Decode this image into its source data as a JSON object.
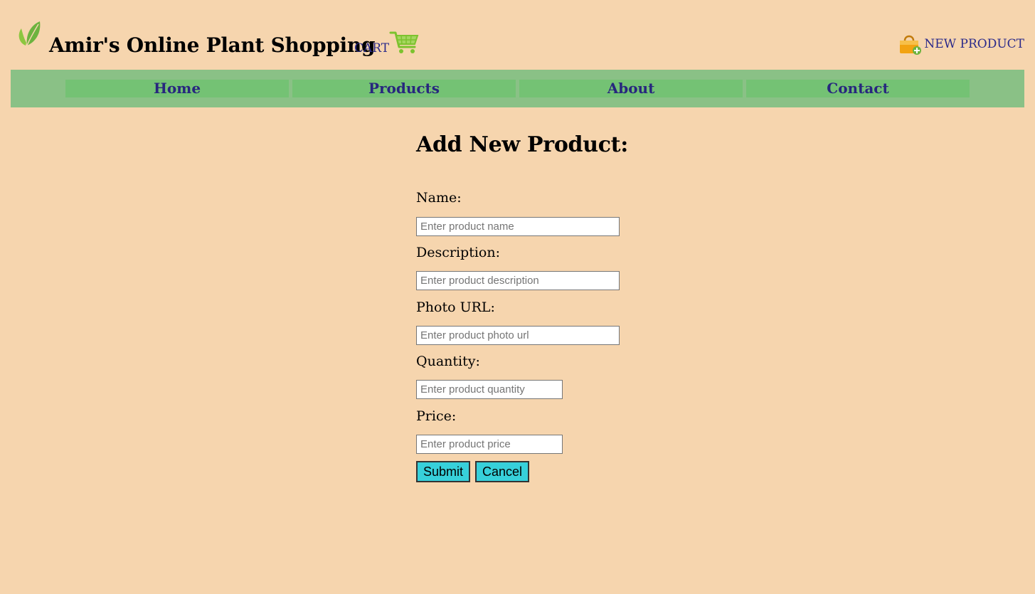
{
  "header": {
    "logo_icon": "leaf-icon",
    "title": "Amir's Online Plant Shopping",
    "cart_label": "CART",
    "cart_icon": "shopping-cart-icon",
    "new_product_icon": "shopping-bag-add-icon",
    "new_product_label": "NEW PRODUCT"
  },
  "nav": {
    "items": [
      {
        "label": "Home"
      },
      {
        "label": "Products"
      },
      {
        "label": "About"
      },
      {
        "label": "Contact"
      }
    ]
  },
  "form": {
    "heading": "Add New Product:",
    "fields": {
      "name": {
        "label": "Name:",
        "placeholder": "Enter product name",
        "value": ""
      },
      "description": {
        "label": "Description:",
        "placeholder": "Enter product description",
        "value": ""
      },
      "photo_url": {
        "label": "Photo URL:",
        "placeholder": "Enter product photo url",
        "value": ""
      },
      "quantity": {
        "label": "Quantity:",
        "placeholder": "Enter product quantity",
        "value": ""
      },
      "price": {
        "label": "Price:",
        "placeholder": "Enter product price",
        "value": ""
      }
    },
    "submit_label": "Submit",
    "cancel_label": "Cancel"
  },
  "colors": {
    "page_background": "#f6d5ae",
    "navbar_background": "#8ac186",
    "nav_item_background": "#74c274",
    "link_color": "#2b2a8a",
    "button_background": "#37d0da",
    "leaf_green": "#7cc22e"
  }
}
